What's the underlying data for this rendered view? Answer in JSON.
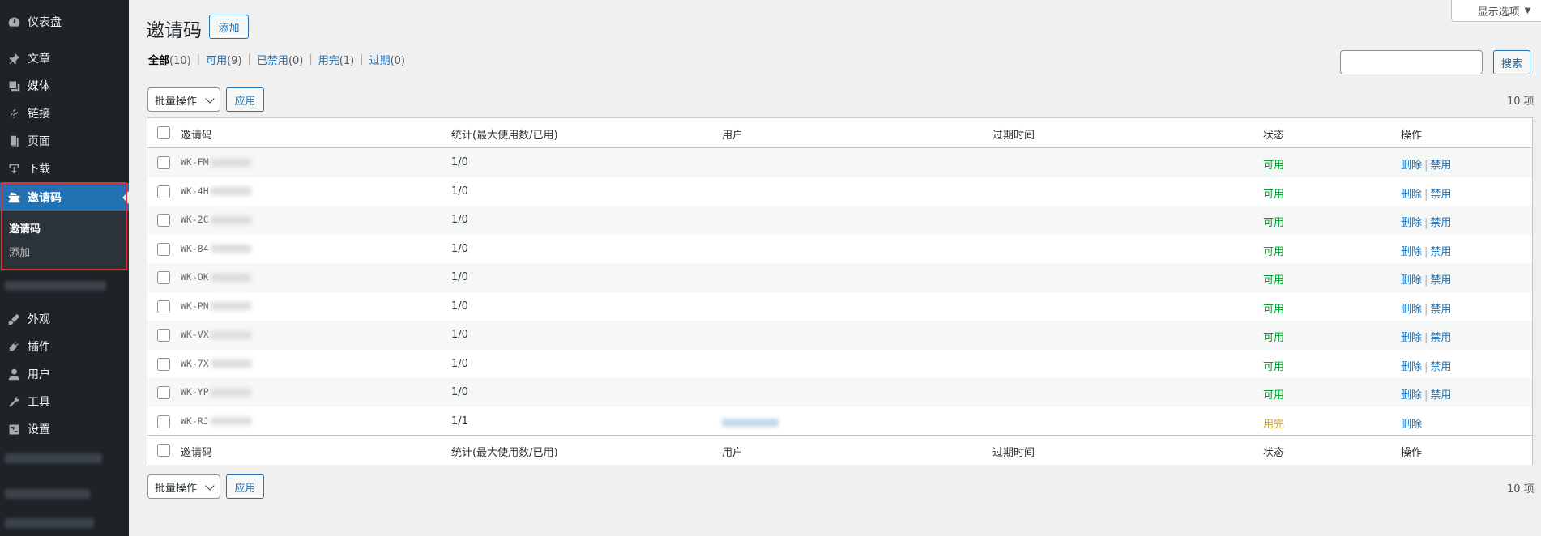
{
  "sidebar": {
    "items": [
      {
        "label": "仪表盘",
        "icon": "dashboard-icon"
      },
      {
        "label": "文章",
        "icon": "pin-icon"
      },
      {
        "label": "媒体",
        "icon": "media-icon"
      },
      {
        "label": "链接",
        "icon": "link-icon"
      },
      {
        "label": "页面",
        "icon": "page-icon"
      },
      {
        "label": "下载",
        "icon": "download-icon"
      },
      {
        "label": "邀请码",
        "icon": "ticket-icon"
      },
      {
        "label": "外观",
        "icon": "appearance-icon"
      },
      {
        "label": "插件",
        "icon": "plugin-icon"
      },
      {
        "label": "用户",
        "icon": "user-icon"
      },
      {
        "label": "工具",
        "icon": "wrench-icon"
      },
      {
        "label": "设置",
        "icon": "settings-icon"
      }
    ],
    "submenu": {
      "current": "邀请码",
      "add": "添加"
    }
  },
  "header": {
    "title": "邀请码",
    "add_button": "添加",
    "screen_options": "显示选项"
  },
  "filters": [
    {
      "label": "全部",
      "count": "(10)"
    },
    {
      "label": "可用",
      "count": "(9)"
    },
    {
      "label": "已禁用",
      "count": "(0)"
    },
    {
      "label": "用完",
      "count": "(1)"
    },
    {
      "label": "过期",
      "count": "(0)"
    }
  ],
  "search": {
    "button": "搜索",
    "value": ""
  },
  "bulk": {
    "select_label": "批量操作",
    "apply_label": "应用",
    "items_count": "10 项"
  },
  "table": {
    "columns": [
      "邀请码",
      "统计(最大使用数/已用)",
      "用户",
      "过期时间",
      "状态",
      "操作"
    ],
    "rows": [
      {
        "code": "WK-FM",
        "stats": "1/0",
        "status": "可用",
        "actions": [
          "删除",
          "禁用"
        ]
      },
      {
        "code": "WK-4H",
        "stats": "1/0",
        "status": "可用",
        "actions": [
          "删除",
          "禁用"
        ]
      },
      {
        "code": "WK-2C",
        "stats": "1/0",
        "status": "可用",
        "actions": [
          "删除",
          "禁用"
        ]
      },
      {
        "code": "WK-84",
        "stats": "1/0",
        "status": "可用",
        "actions": [
          "删除",
          "禁用"
        ]
      },
      {
        "code": "WK-OK",
        "stats": "1/0",
        "status": "可用",
        "actions": [
          "删除",
          "禁用"
        ]
      },
      {
        "code": "WK-PN",
        "stats": "1/0",
        "status": "可用",
        "actions": [
          "删除",
          "禁用"
        ]
      },
      {
        "code": "WK-VX",
        "stats": "1/0",
        "status": "可用",
        "actions": [
          "删除",
          "禁用"
        ]
      },
      {
        "code": "WK-7X",
        "stats": "1/0",
        "status": "可用",
        "actions": [
          "删除",
          "禁用"
        ]
      },
      {
        "code": "WK-YP",
        "stats": "1/0",
        "status": "可用",
        "actions": [
          "删除",
          "禁用"
        ]
      },
      {
        "code": "WK-RJ",
        "stats": "1/1",
        "status": "用完",
        "actions": [
          "删除"
        ]
      }
    ]
  },
  "colors": {
    "accent": "#2271b1",
    "sidebar": "#1d2327",
    "available": "#00a32a",
    "used": "#dba617",
    "highlight_border": "#d63638"
  }
}
